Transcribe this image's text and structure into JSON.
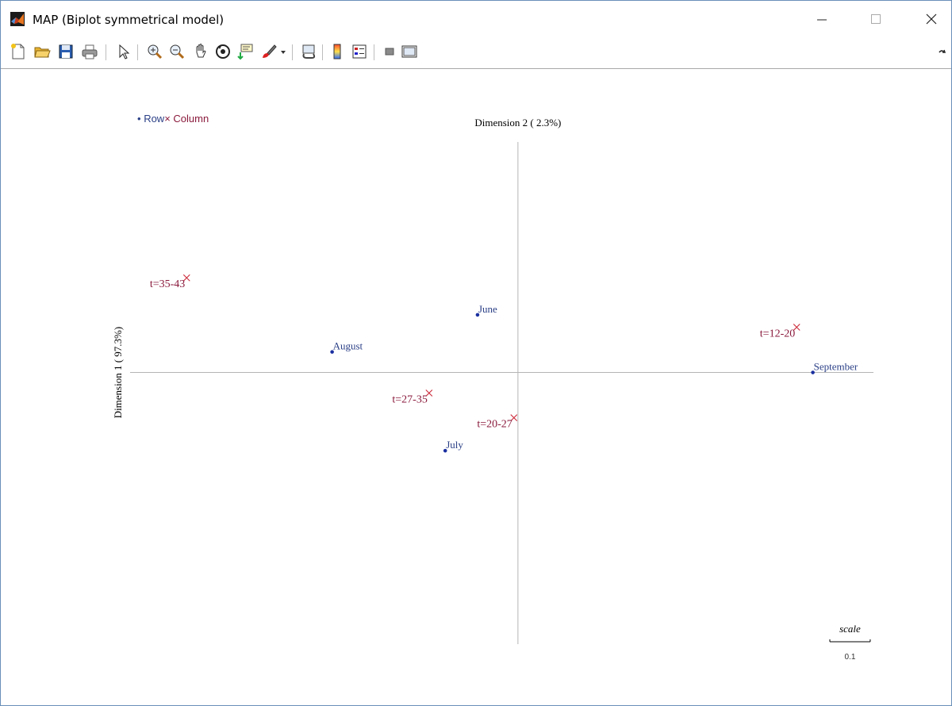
{
  "window": {
    "title": "MAP (Biplot symmetrical model)",
    "buttons": {
      "minimize": "minimize",
      "maximize": "maximize",
      "close": "close"
    }
  },
  "toolbar": {
    "items": [
      "new-figure",
      "open-file",
      "save",
      "print",
      "edit-pointer",
      "zoom-in",
      "zoom-out",
      "pan",
      "rotate-3d",
      "data-cursor",
      "brush",
      "brush-dropdown",
      "link-plot",
      "colorbar",
      "legend",
      "hide-plot-tools",
      "show-plot-tools"
    ]
  },
  "legend": {
    "row_label": "Row",
    "column_label": "Column",
    "row_marker": "•",
    "column_marker": "×"
  },
  "colors": {
    "row": "#1a2fa0",
    "column": "#cc2a3a",
    "row_text": "#2a3f86",
    "column_text": "#8a1a3c",
    "axis": "#b5b5b5"
  },
  "chart_data": {
    "type": "scatter",
    "xlabel": "Dimension 2 ( 2.3%)",
    "ylabel": "Dimension 1 ( 97.3%)",
    "xlim": [
      -0.48,
      0.44
    ],
    "ylim": [
      -0.33,
      0.28
    ],
    "grid": false,
    "legend_position": "top-left",
    "series": [
      {
        "name": "Row",
        "marker": "dot",
        "points": [
          {
            "label": "June",
            "x": -0.05,
            "y": 0.07
          },
          {
            "label": "August",
            "x": -0.23,
            "y": 0.025
          },
          {
            "label": "September",
            "x": 0.365,
            "y": 0.0
          },
          {
            "label": "July",
            "x": -0.09,
            "y": -0.095
          }
        ]
      },
      {
        "name": "Column",
        "marker": "x",
        "points": [
          {
            "label": "t=35-43",
            "x": -0.41,
            "y": 0.115
          },
          {
            "label": "t=12-20",
            "x": 0.345,
            "y": 0.055
          },
          {
            "label": "t=27-35",
            "x": -0.11,
            "y": -0.025
          },
          {
            "label": "t=20-27",
            "x": -0.005,
            "y": -0.055
          }
        ]
      }
    ],
    "scale_bar": {
      "label": "scale",
      "value": "0.1",
      "length": 0.05
    }
  }
}
